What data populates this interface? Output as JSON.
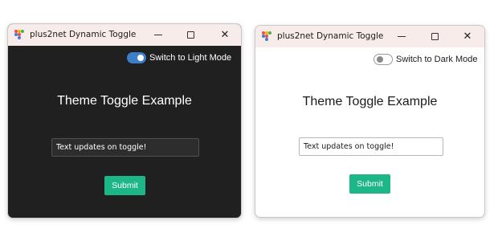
{
  "colors": {
    "dark_bg": "#202020",
    "light_bg": "#ffffff",
    "titlebar_bg": "#f7ece9",
    "accent": "#1db787",
    "toggle_on": "#3c7ec9",
    "toggle_off_border": "#9a9a9a"
  },
  "windows": [
    {
      "mode": "dark",
      "title": "plus2net Dynamic Toggle",
      "controls": {
        "minimize": "—",
        "maximize": "☐",
        "close": "✕"
      },
      "toggle": {
        "label": "Switch to Light Mode",
        "checked": true
      },
      "heading": "Theme Toggle Example",
      "input": {
        "value": "Text updates on toggle!"
      },
      "button": {
        "label": "Submit"
      }
    },
    {
      "mode": "light",
      "title": "plus2net Dynamic Toggle",
      "controls": {
        "minimize": "—",
        "maximize": "☐",
        "close": "✕"
      },
      "toggle": {
        "label": "Switch to Dark Mode",
        "checked": false
      },
      "heading": "Theme Toggle Example",
      "input": {
        "value": "Text updates on toggle!"
      },
      "button": {
        "label": "Submit"
      }
    }
  ]
}
